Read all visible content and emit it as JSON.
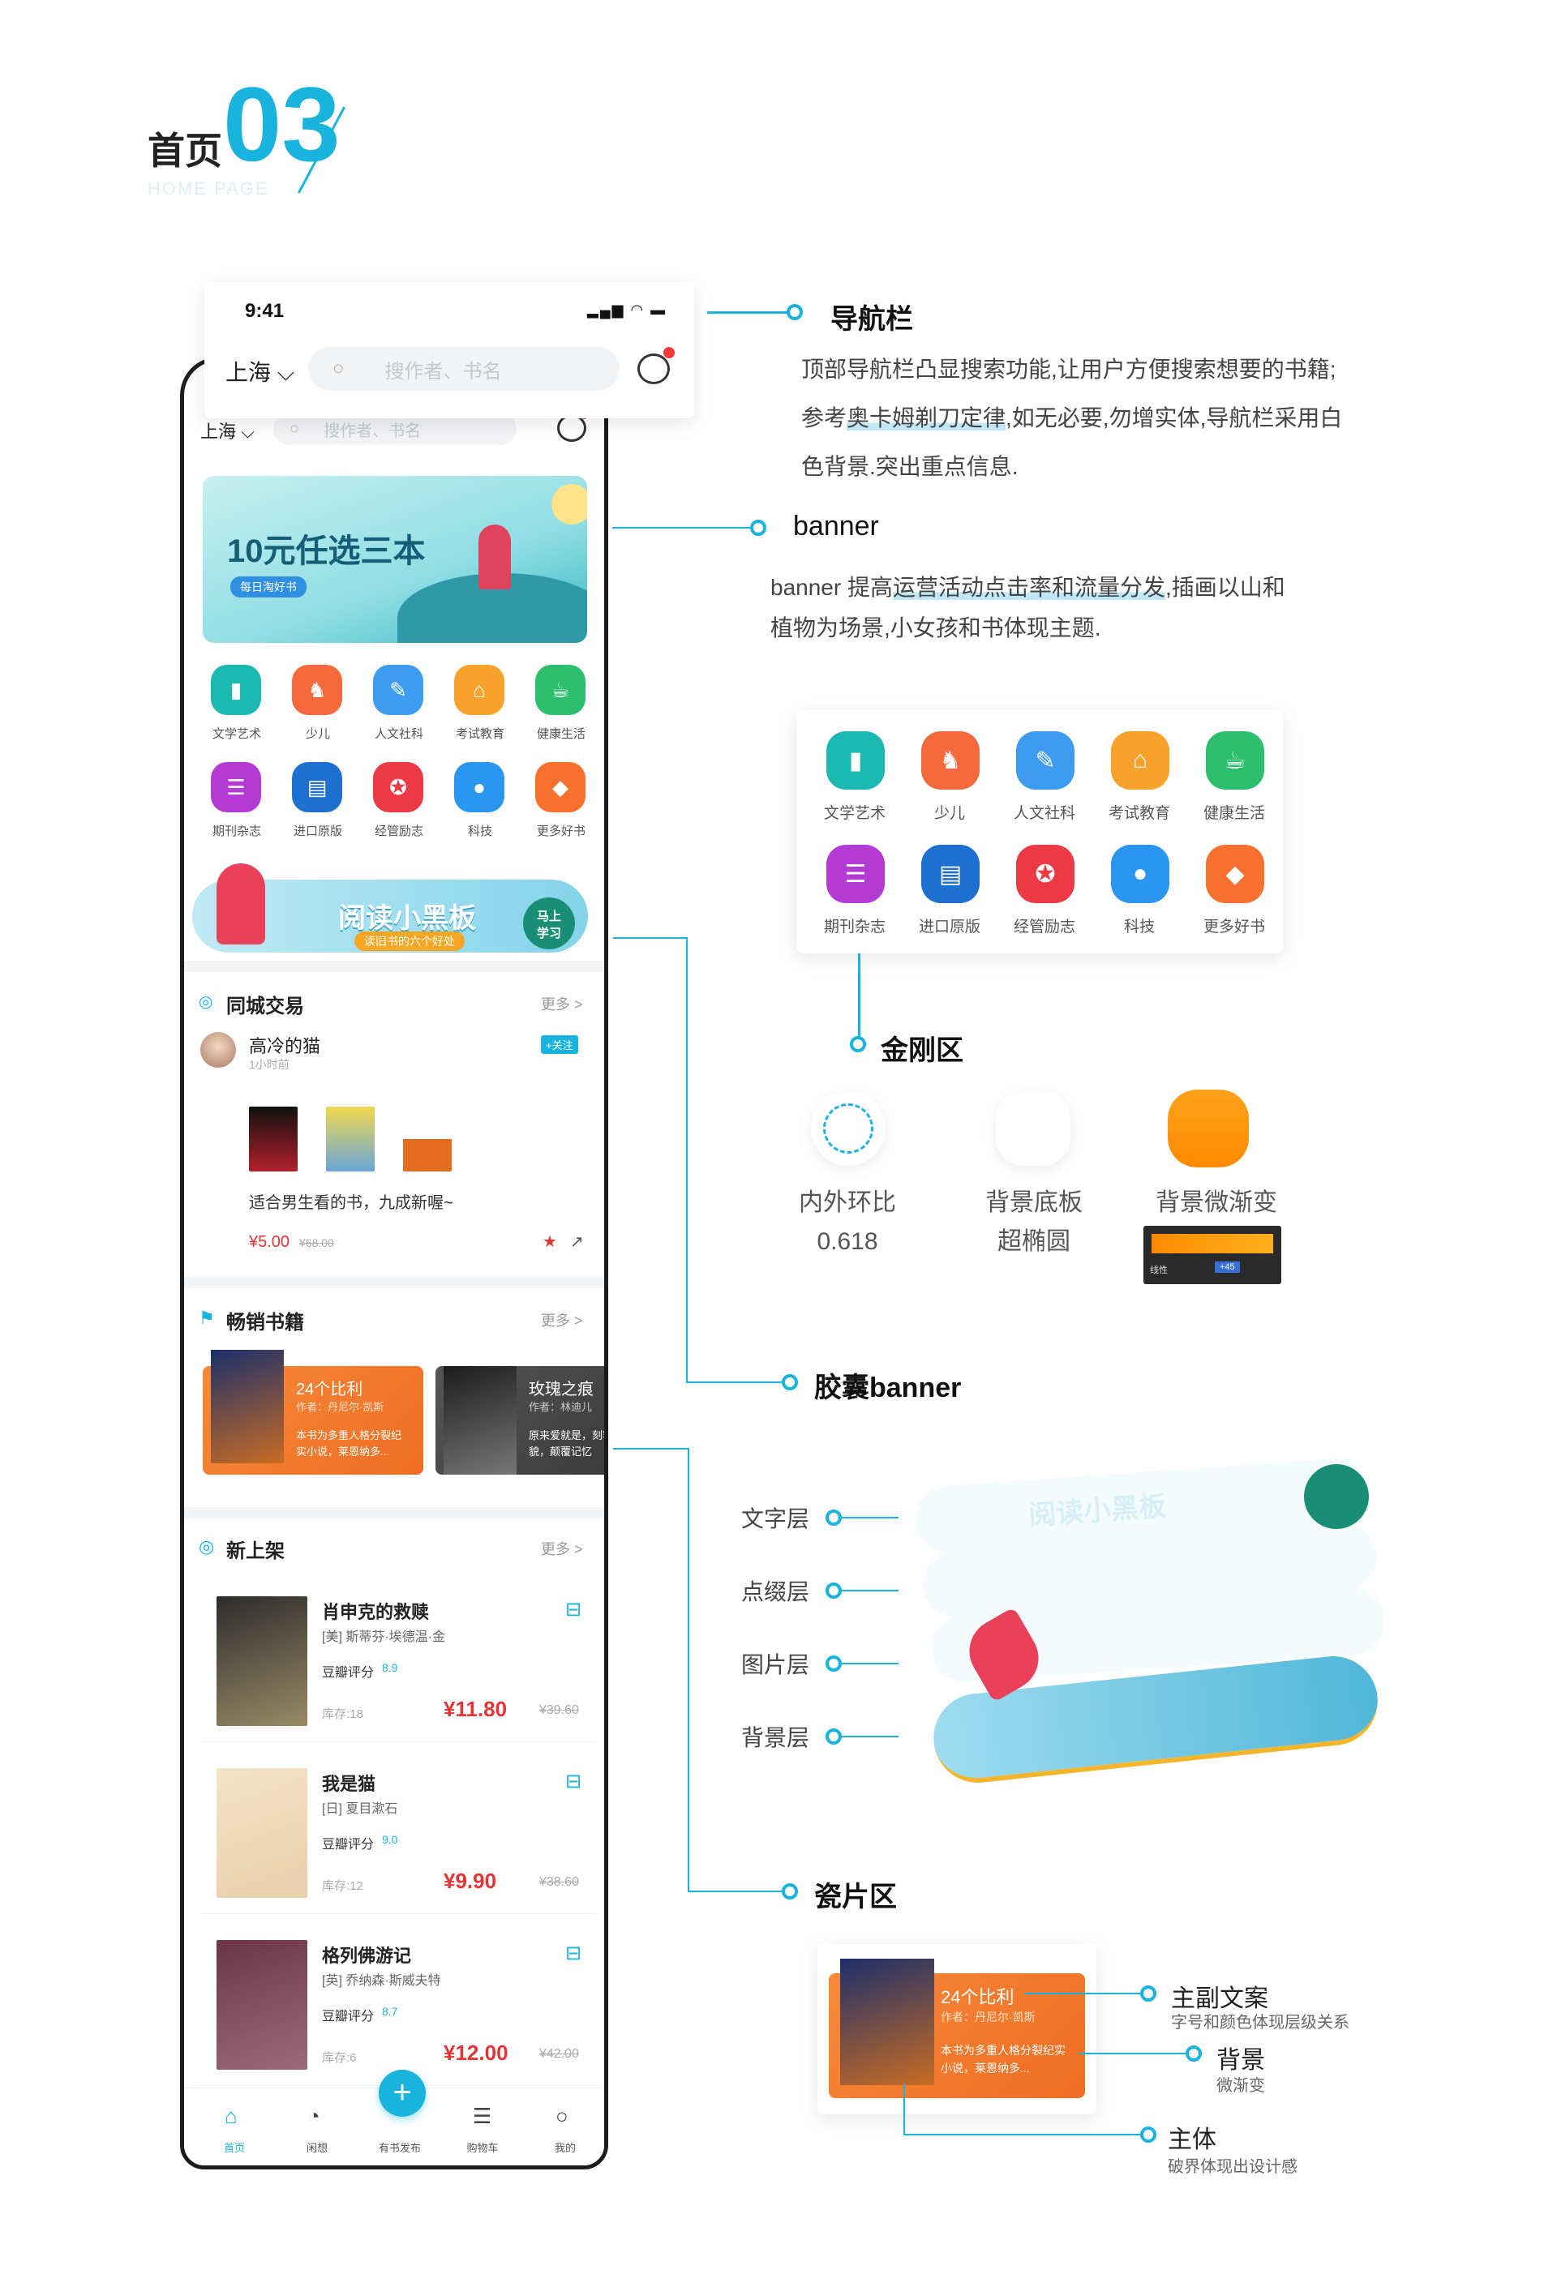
{
  "header": {
    "title": "首页",
    "number": "03",
    "subtitle": "HOME PAGE"
  },
  "status_bar": {
    "time": "9:41"
  },
  "nav": {
    "city": "上海",
    "search_placeholder": "搜作者、书名"
  },
  "banner": {
    "headline": "10元任选三本",
    "tag": "每日淘好书"
  },
  "categories": [
    {
      "label": "文学艺术",
      "icon": "book-icon",
      "color": "#1bb9b0"
    },
    {
      "label": "少儿",
      "icon": "rocking-horse-icon",
      "color": "#f56a3c"
    },
    {
      "label": "人文社科",
      "icon": "footprint-icon",
      "color": "#3d9bf0"
    },
    {
      "label": "考试教育",
      "icon": "graduation-cap-icon",
      "color": "#f8a12b"
    },
    {
      "label": "健康生活",
      "icon": "cup-icon",
      "color": "#2dbf6e"
    },
    {
      "label": "期刊杂志",
      "icon": "magazine-icon",
      "color": "#b43ad6"
    },
    {
      "label": "进口原版",
      "icon": "hardcover-icon",
      "color": "#1f6fd1"
    },
    {
      "label": "经管励志",
      "icon": "award-icon",
      "color": "#ec3a45"
    },
    {
      "label": "科技",
      "icon": "bulb-icon",
      "color": "#2b96ef"
    },
    {
      "label": "更多好书",
      "icon": "blocks-icon",
      "color": "#f8702d"
    }
  ],
  "capsule": {
    "title": "阅读小黑板",
    "subtitle": "读旧书的六个好处",
    "button": "马上\n学习"
  },
  "trade": {
    "title": "同城交易",
    "more": "更多 >",
    "user": "高冷的猫",
    "time": "1小时前",
    "follow": "+关注",
    "desc": "适合男生看的书，九成新喔~",
    "price": "¥5.00",
    "old_price": "¥68.00"
  },
  "bestseller": {
    "title": "畅销书籍",
    "more": "更多 >",
    "cards": [
      {
        "title": "24个比利",
        "author": "作者：丹尼尔·凯斯",
        "desc": "本书为多重人格分裂纪实小说，莱恩纳多..."
      },
      {
        "title": "玫瑰之痕",
        "author": "作者：林迪儿",
        "desc": "原来爱就是，刻容貌，颠覆记忆"
      }
    ]
  },
  "new_books": {
    "title": "新上架",
    "more": "更多 >",
    "items": [
      {
        "title": "肖申克的救赎",
        "author": "[美] 斯蒂芬·埃德温·金",
        "rating_label": "豆瓣评分",
        "rating": "8.9",
        "stock": "库存:18",
        "price": "¥11.80",
        "old_price": "¥39.60"
      },
      {
        "title": "我是猫",
        "author": "[日] 夏目漱石",
        "rating_label": "豆瓣评分",
        "rating": "9.0",
        "stock": "库存:12",
        "price": "¥9.90",
        "old_price": "¥38.60"
      },
      {
        "title": "格列佛游记",
        "author": "[英] 乔纳森·斯威夫特",
        "rating_label": "豆瓣评分",
        "rating": "8.7",
        "stock": "库存:6",
        "price": "¥12.00",
        "old_price": "¥42.00"
      }
    ]
  },
  "tabbar": {
    "items": [
      "首页",
      "闲想",
      "有书发布",
      "购物车",
      "我的"
    ]
  },
  "annotations": {
    "nav_title": "导航栏",
    "nav_text_1": "顶部导航栏凸显搜索功能,让用户方便搜索想要的书籍;",
    "nav_text_2a": "参考",
    "nav_text_2b": "奥卡姆剃刀定律",
    "nav_text_2c": ",如无必要,勿增实体,导航栏采用白",
    "nav_text_3": "色背景.突出重点信息.",
    "banner_title": "banner",
    "banner_text_1a": "banner 提高",
    "banner_text_1b": "运营活动点击率和流量分发",
    "banner_text_1c": ",插画以山和",
    "banner_text_2": "植物为场景,小女孩和书体现主题.",
    "kingkong_title": "金刚区",
    "kk_items": [
      {
        "l1": "内外环比",
        "l2": "0.618"
      },
      {
        "l1": "背景底板",
        "l2": "超椭圆"
      },
      {
        "l1": "背景微渐变",
        "l2": ""
      }
    ],
    "capsule_title": "胶囊banner",
    "layers": [
      "文字层",
      "点缀层",
      "图片层",
      "背景层"
    ],
    "tile_title": "瓷片区",
    "tile_notes": [
      {
        "title": "主副文案",
        "sub": "字号和颜色体现层级关系"
      },
      {
        "title": "背景",
        "sub": "微渐变"
      },
      {
        "title": "主体",
        "sub": "破界体现出设计感"
      }
    ],
    "grad_ui_text": "线性",
    "grad_ui_value": "+45"
  },
  "colors": {
    "accent": "#18b4de",
    "orange": "#f47a2a",
    "price_red": "#e73333"
  }
}
